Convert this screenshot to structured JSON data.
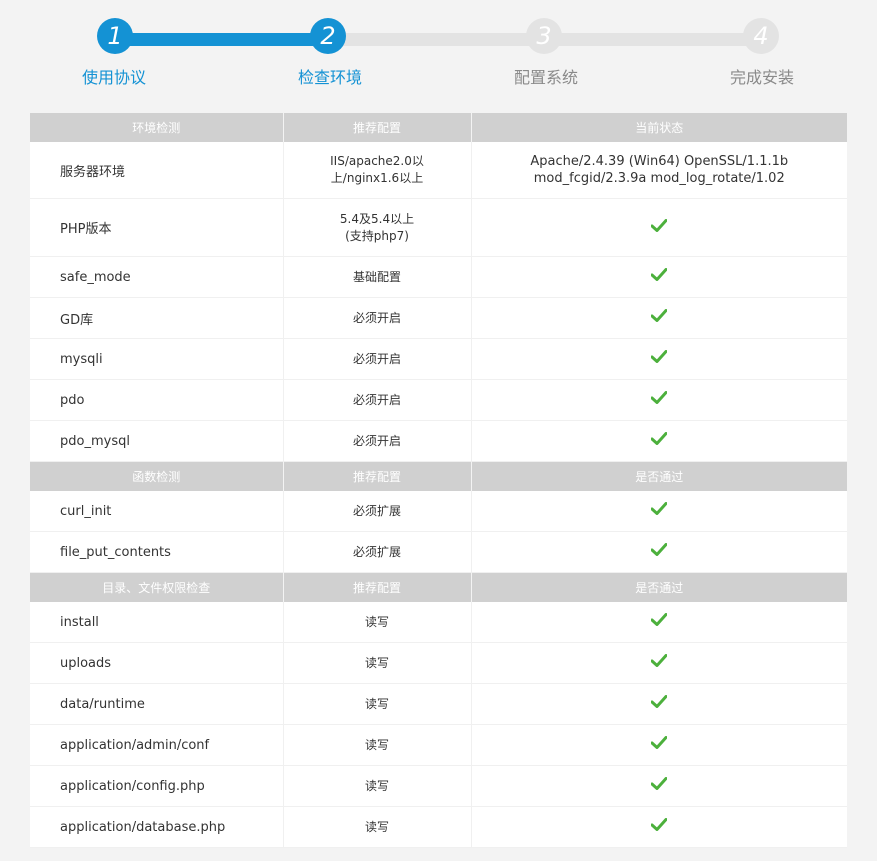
{
  "steps": [
    {
      "num": "1",
      "label": "使用协议",
      "state": "done"
    },
    {
      "num": "2",
      "label": "检查环境",
      "state": "active"
    },
    {
      "num": "3",
      "label": "配置系统",
      "state": "inactive"
    },
    {
      "num": "4",
      "label": "完成安装",
      "state": "inactive"
    }
  ],
  "colors": {
    "accent": "#1492d4",
    "inactive": "#e3e3e3",
    "check": "#4cb03c",
    "header_bg": "#d0d0d0"
  },
  "sections": [
    {
      "headers": [
        "环境检测",
        "推荐配置",
        "当前状态"
      ],
      "rows": [
        {
          "name": "服务器环境",
          "rec": [
            "IIS/apache2.0以",
            "上/nginx1.6以上"
          ],
          "status": [
            "Apache/2.4.39 (Win64) OpenSSL/1.1.1b",
            "mod_fcgid/2.3.9a mod_log_rotate/1.02"
          ]
        },
        {
          "name": "PHP版本",
          "rec": [
            "5.4及5.4以上",
            "(支持php7)"
          ],
          "status": "check"
        },
        {
          "name": "safe_mode",
          "rec": "基础配置",
          "status": "check"
        },
        {
          "name": "GD库",
          "rec": "必须开启",
          "status": "check"
        },
        {
          "name": "mysqli",
          "rec": "必须开启",
          "status": "check"
        },
        {
          "name": "pdo",
          "rec": "必须开启",
          "status": "check"
        },
        {
          "name": "pdo_mysql",
          "rec": "必须开启",
          "status": "check"
        }
      ]
    },
    {
      "headers": [
        "函数检测",
        "推荐配置",
        "是否通过"
      ],
      "rows": [
        {
          "name": "curl_init",
          "rec": "必须扩展",
          "status": "check"
        },
        {
          "name": "file_put_contents",
          "rec": "必须扩展",
          "status": "check"
        }
      ]
    },
    {
      "headers": [
        "目录、文件权限检查",
        "推荐配置",
        "是否通过"
      ],
      "rows": [
        {
          "name": "install",
          "rec": "读写",
          "status": "check"
        },
        {
          "name": "uploads",
          "rec": "读写",
          "status": "check"
        },
        {
          "name": "data/runtime",
          "rec": "读写",
          "status": "check"
        },
        {
          "name": "application/admin/conf",
          "rec": "读写",
          "status": "check"
        },
        {
          "name": "application/config.php",
          "rec": "读写",
          "status": "check"
        },
        {
          "name": "application/database.php",
          "rec": "读写",
          "status": "check"
        }
      ]
    }
  ]
}
